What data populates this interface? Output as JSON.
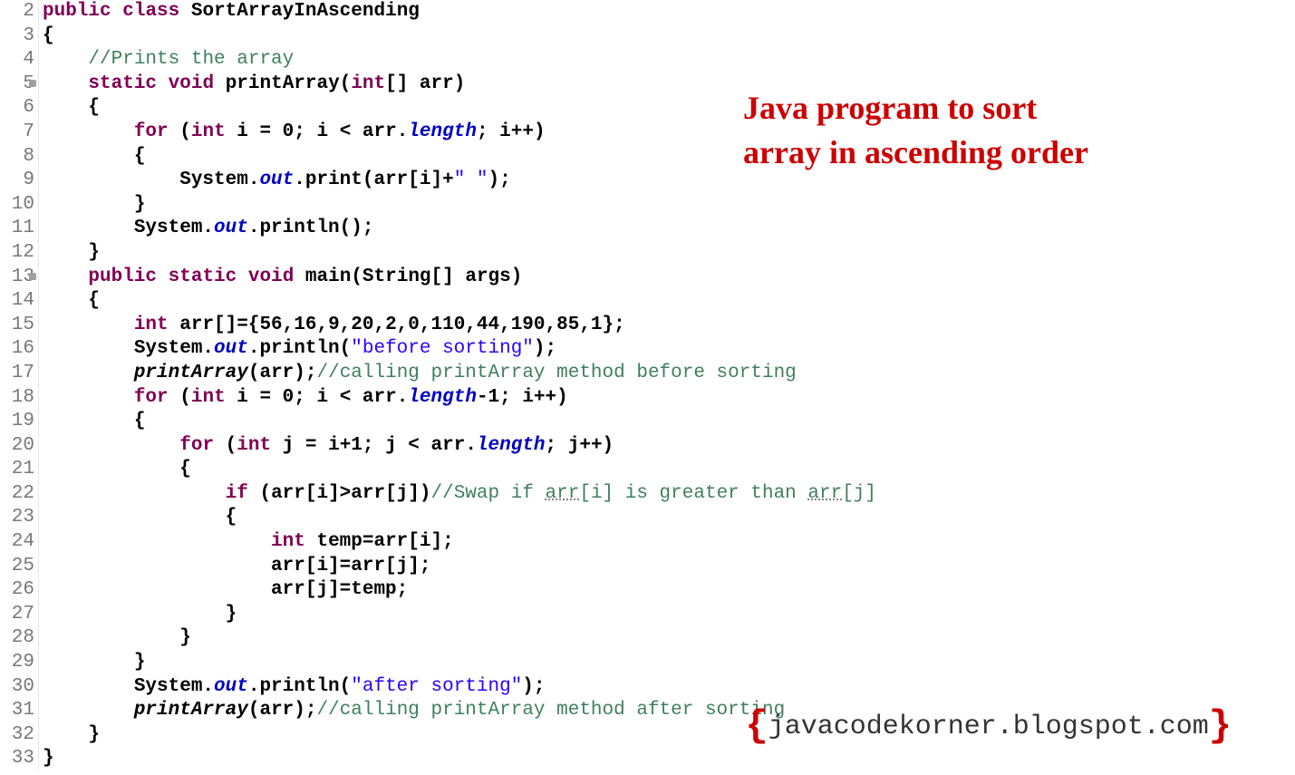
{
  "lineNumbers": [
    "2",
    "3",
    "4",
    "5",
    "6",
    "7",
    "8",
    "9",
    "10",
    "11",
    "12",
    "13",
    "14",
    "15",
    "16",
    "17",
    "18",
    "19",
    "20",
    "21",
    "22",
    "23",
    "24",
    "25",
    "26",
    "27",
    "28",
    "29",
    "30",
    "31",
    "32",
    "33"
  ],
  "overlay": {
    "title_line1": "Java program to sort",
    "title_line2": "array in ascending order"
  },
  "watermark": {
    "text": "javacodekorner.blogspot.com"
  },
  "code": {
    "l2": {
      "kw1": "public",
      "kw2": "class",
      "name": "SortArrayInAscending"
    },
    "l3": {
      "text": "{"
    },
    "l4": {
      "comment": "//Prints the array"
    },
    "l5": {
      "kw1": "static",
      "kw2": "void",
      "name": "printArray(",
      "kw3": "int",
      "rest": "[] arr)"
    },
    "l6": {
      "text": "    {"
    },
    "l7": {
      "kw1": "for",
      "text1": " (",
      "kw2": "int",
      "text2": " i = 0; i < arr.",
      "field": "length",
      "text3": "; i++)"
    },
    "l8": {
      "text": "        {"
    },
    "l9": {
      "text1": "            System.",
      "field": "out",
      "text2": ".print(arr[i]+",
      "str": "\" \"",
      "text3": ");"
    },
    "l10": {
      "text": "        }"
    },
    "l11": {
      "text1": "        System.",
      "field": "out",
      "text2": ".println();"
    },
    "l12": {
      "text": "    }"
    },
    "l13": {
      "kw1": "public",
      "kw2": "static",
      "kw3": "void",
      "text": " main(String[] args)"
    },
    "l14": {
      "text": "    {"
    },
    "l15": {
      "kw": "int",
      "text": " arr[]={56,16,9,20,2,0,110,44,190,85,1};"
    },
    "l16": {
      "text1": "        System.",
      "field": "out",
      "text2": ".println(",
      "str": "\"before sorting\"",
      "text3": ");"
    },
    "l17": {
      "method": "printArray",
      "text": "(arr);",
      "comment": "//calling printArray method before sorting"
    },
    "l18": {
      "kw1": "for",
      "text1": " (",
      "kw2": "int",
      "text2": " i = 0; i < arr.",
      "field": "length",
      "text3": "-1; i++)"
    },
    "l19": {
      "text": "        {"
    },
    "l20": {
      "kw1": "for",
      "text1": " (",
      "kw2": "int",
      "text2": " j = i+1; j < arr.",
      "field": "length",
      "text3": "; j++)"
    },
    "l21": {
      "text": "            {"
    },
    "l22": {
      "kw": "if",
      "text1": " (arr[i]>arr[j])",
      "comment1": "//Swap if ",
      "u1": "arr",
      "comment2": "[i] is greater than ",
      "u2": "arr",
      "comment3": "[j]"
    },
    "l23": {
      "text": "                {"
    },
    "l24": {
      "kw": "int",
      "text": " temp=arr[i];"
    },
    "l25": {
      "text": "                    arr[i]=arr[j];"
    },
    "l26": {
      "text": "                    arr[j]=temp;"
    },
    "l27": {
      "text": "                }"
    },
    "l28": {
      "text": "            }"
    },
    "l29": {
      "text": "        }"
    },
    "l30": {
      "text1": "        System.",
      "field": "out",
      "text2": ".println(",
      "str": "\"after sorting\"",
      "text3": ");"
    },
    "l31": {
      "method": "printArray",
      "text": "(arr);",
      "comment": "//calling printArray method after sorting"
    },
    "l32": {
      "text": "    }"
    },
    "l33": {
      "text": "}"
    }
  }
}
